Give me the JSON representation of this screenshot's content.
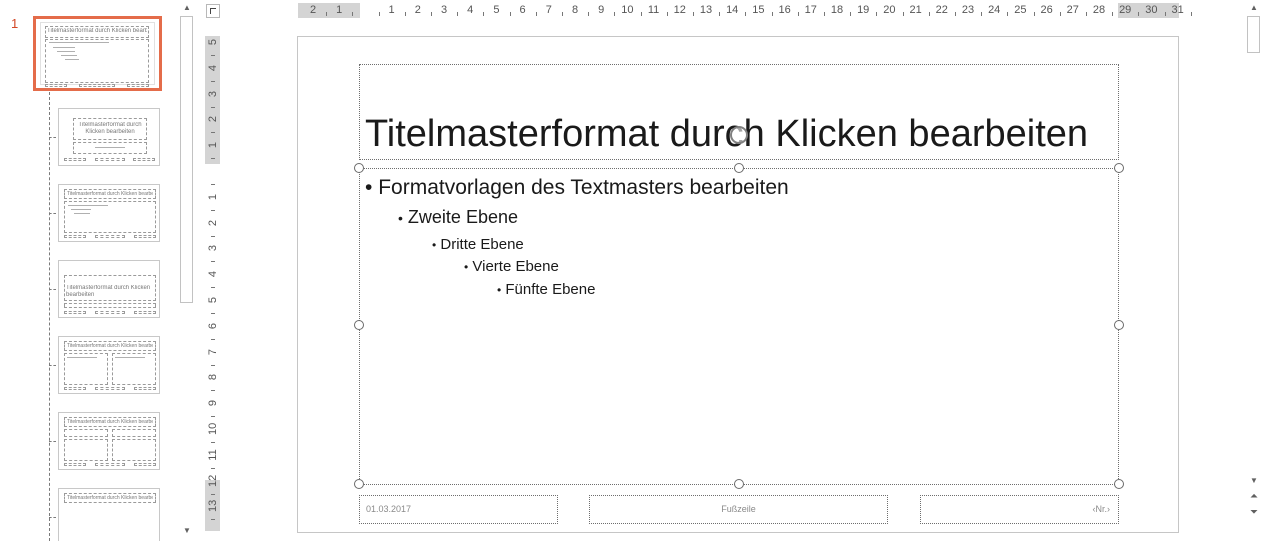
{
  "thumbnail_pane": {
    "master_number": "1",
    "master_title": "Titelmasterformat durch Klicken bearbeiten",
    "layouts": [
      {
        "kind": "title",
        "text": "Titelmasterformat durch Klicken bearbeiten"
      },
      {
        "kind": "content",
        "text": "Titelmasterformat durch Klicken bearbeiten"
      },
      {
        "kind": "section",
        "text": "Titelmasterformat durch Klicken bearbeiten"
      },
      {
        "kind": "two",
        "text": "Titelmasterformat durch Klicken bearbeiten"
      },
      {
        "kind": "compare",
        "text": "Titelmasterformat durch Klicken bearbeiten"
      },
      {
        "kind": "titleonly",
        "text": "Titelmasterformat durch Klicken bearbeiten"
      }
    ]
  },
  "ruler": {
    "horizontal": [
      "2",
      "1",
      "",
      "1",
      "2",
      "3",
      "4",
      "5",
      "6",
      "7",
      "8",
      "9",
      "10",
      "11",
      "12",
      "13",
      "14",
      "15",
      "16",
      "17",
      "18",
      "19",
      "20",
      "21",
      "22",
      "23",
      "24",
      "25",
      "26",
      "27",
      "28",
      "29",
      "30",
      "31"
    ],
    "vertical": [
      "5",
      "4",
      "3",
      "2",
      "1",
      "",
      "1",
      "2",
      "3",
      "4",
      "5",
      "6",
      "7",
      "8",
      "9",
      "10",
      "11",
      "12",
      "13"
    ]
  },
  "slide": {
    "title": "Titelmasterformat durch Klicken bearbeiten",
    "levels": [
      {
        "text": "Formatvorlagen des Textmasters bearbeiten"
      },
      {
        "text": "Zweite Ebene"
      },
      {
        "text": "Dritte Ebene"
      },
      {
        "text": "Vierte Ebene"
      },
      {
        "text": "Fünfte Ebene"
      }
    ],
    "footer_date": "01.03.2017",
    "footer_text": "Fußzeile",
    "footer_number": "‹Nr.›"
  },
  "icons": {
    "bullet": "•",
    "scroll_up": "▲",
    "scroll_down": "▼",
    "prev_slide": "⏶",
    "next_slide": "⏷"
  },
  "colors": {
    "selected_border": "#e46c4a",
    "slide_number": "#d24726",
    "ruler_shade": "#d4d4d4"
  }
}
